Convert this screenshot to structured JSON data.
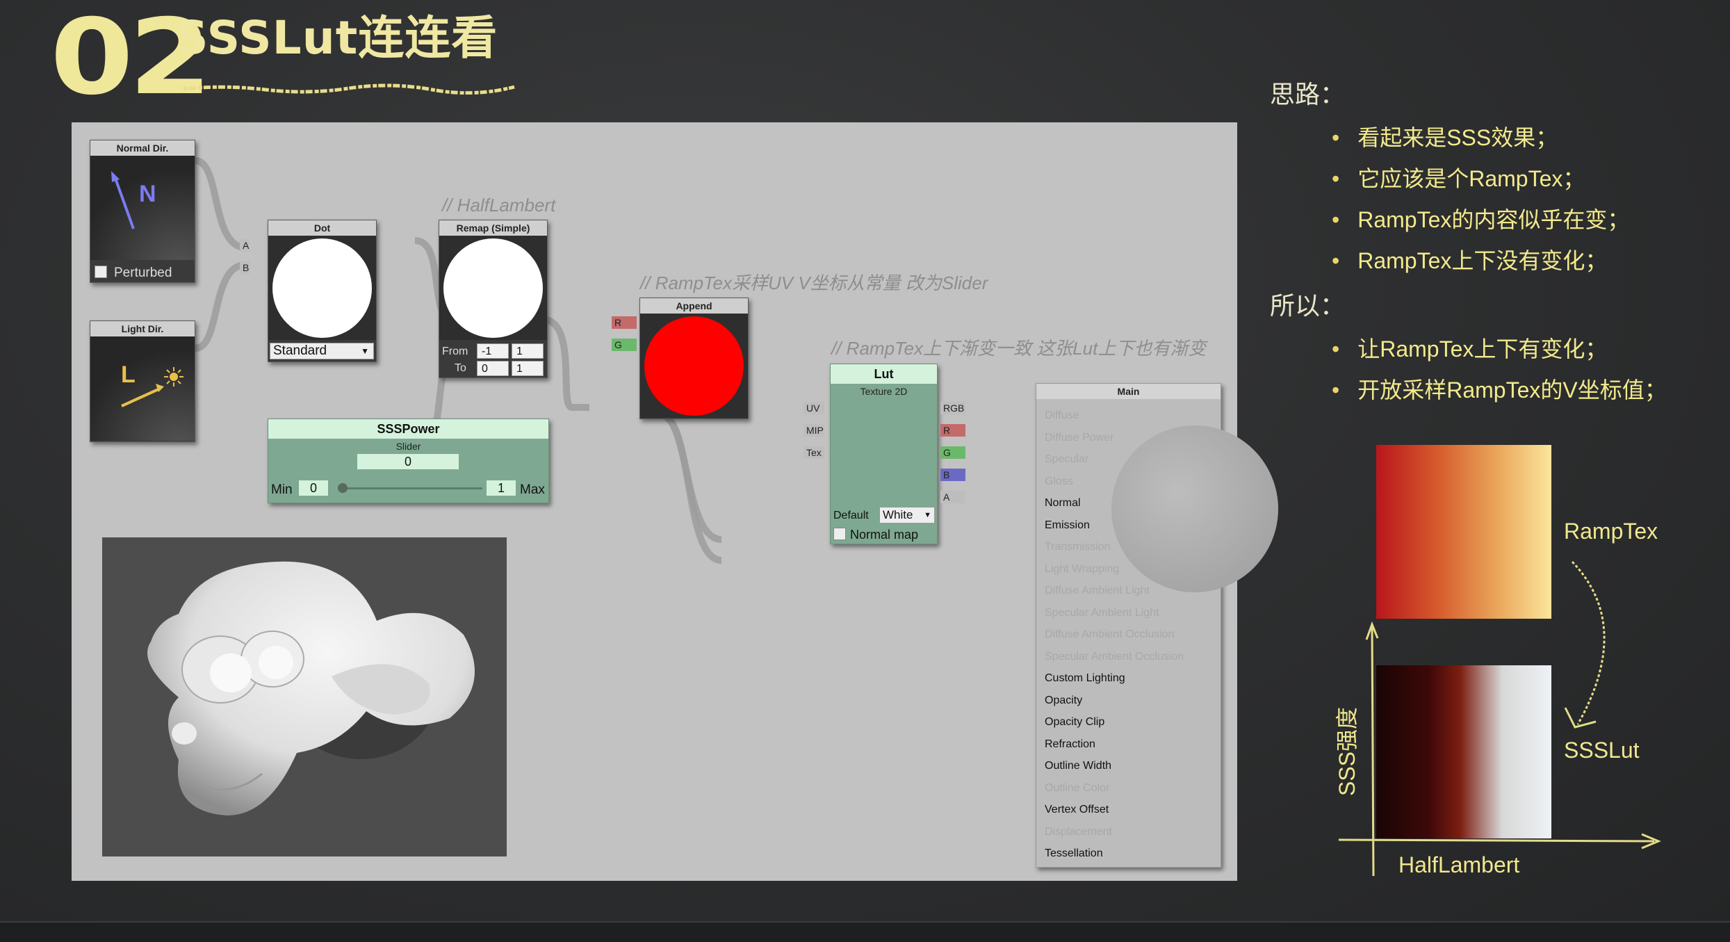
{
  "slide": {
    "number": "02",
    "title": "SSSLut连连看"
  },
  "canvas": {
    "nodes": {
      "normal_dir": {
        "title": "Normal Dir.",
        "glyph": "N",
        "checkbox_label": "Perturbed"
      },
      "light_dir": {
        "title": "Light Dir.",
        "glyph": "L"
      },
      "dot": {
        "title": "Dot",
        "dropdown": "Standard",
        "inputs": [
          "A",
          "B"
        ]
      },
      "remap": {
        "title": "Remap (Simple)",
        "from_label": "From",
        "to_label": "To",
        "from_min": "-1",
        "from_max": "1",
        "to_min": "0",
        "to_max": "1"
      },
      "append": {
        "title": "Append",
        "inputs": [
          "R",
          "G"
        ]
      },
      "ssspower": {
        "name": "SSSPower",
        "type": "Slider",
        "value": "0",
        "min_label": "Min",
        "min": "0",
        "max": "1",
        "max_label": "Max"
      },
      "lut": {
        "name": "Lut",
        "type": "Texture 2D",
        "inputs": [
          "UV",
          "MIP",
          "Tex"
        ],
        "outputs": [
          "RGB",
          "R",
          "G",
          "B",
          "A"
        ],
        "default_label": "Default",
        "default_value": "White",
        "normal_map_label": "Normal map"
      },
      "main": {
        "title": "Main",
        "rows": [
          {
            "label": "Diffuse",
            "active": false
          },
          {
            "label": "Diffuse Power",
            "active": false
          },
          {
            "label": "Specular",
            "active": false
          },
          {
            "label": "Gloss",
            "active": false
          },
          {
            "label": "Normal",
            "active": true
          },
          {
            "label": "Emission",
            "active": true
          },
          {
            "label": "Transmission",
            "active": false
          },
          {
            "label": "Light Wrapping",
            "active": false
          },
          {
            "label": "Diffuse Ambient Light",
            "active": false
          },
          {
            "label": "Specular Ambient Light",
            "active": false
          },
          {
            "label": "Diffuse Ambient Occlusion",
            "active": false
          },
          {
            "label": "Specular Ambient Occlusion",
            "active": false
          },
          {
            "label": "Custom Lighting",
            "active": true
          },
          {
            "label": "Opacity",
            "active": true
          },
          {
            "label": "Opacity Clip",
            "active": true
          },
          {
            "label": "Refraction",
            "active": true
          },
          {
            "label": "Outline Width",
            "active": true
          },
          {
            "label": "Outline Color",
            "active": false
          },
          {
            "label": "Vertex Offset",
            "active": true
          },
          {
            "label": "Displacement",
            "active": false
          },
          {
            "label": "Tessellation",
            "active": true
          }
        ]
      }
    },
    "comments": {
      "halflambert": "// HalfLambert",
      "ramptex_uv": "// RampTex采样UV V坐标从常量 改为Slider",
      "ramptex_lut": "// RampTex上下渐变一致 这张Lut上下也有渐变"
    }
  },
  "right": {
    "heading1": "思路：",
    "points1": [
      "看起来是SSS效果；",
      "它应该是个RampTex；",
      "RampTex的内容似乎在变；",
      "RampTex上下没有变化；"
    ],
    "heading2": "所以：",
    "points2": [
      "让RampTex上下有变化；",
      "开放采样RampTex的V坐标值；"
    ],
    "figure": {
      "top_label": "RampTex",
      "bottom_label": "SSSLut",
      "y_axis": "SSS强度",
      "x_axis": "HalfLambert"
    }
  },
  "colors": {
    "accent_yellow": "#f3ea8d",
    "red_output": "#ff0000",
    "canvas_bg": "#c2c2c2",
    "node_green": "#7ea891"
  }
}
